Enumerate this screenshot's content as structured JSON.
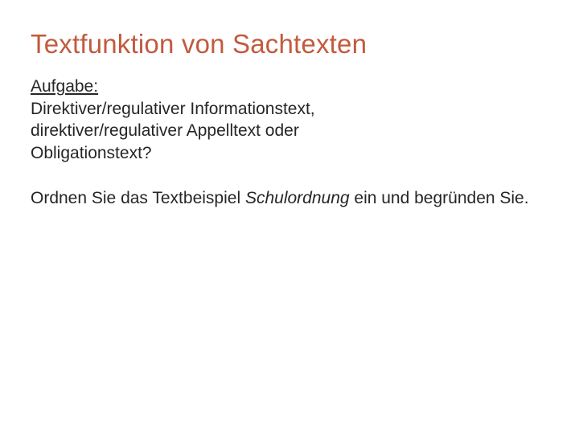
{
  "title": "Textfunktion von Sachtexten",
  "task_label": "Aufgabe:",
  "line1": "Direktiver/regulativer Informationstext,",
  "line2": "direktiver/regulativer Appelltext oder",
  "line3": "Obligationstext?",
  "instr_pre": "Ordnen Sie das Textbeispiel ",
  "instr_italic": "Schulordnung",
  "instr_post": " ein und begründen Sie."
}
